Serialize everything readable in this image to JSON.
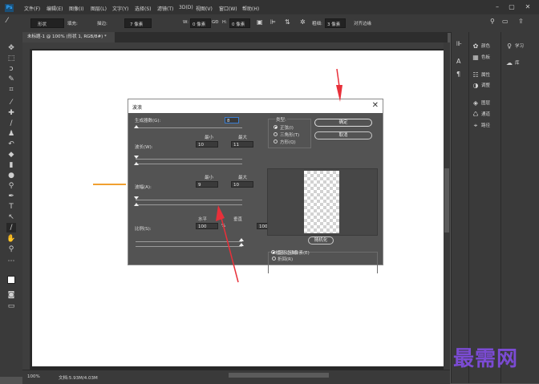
{
  "app": {
    "logo_text": "Ps"
  },
  "menubar": {
    "items": [
      "文件(F)",
      "编辑(E)",
      "图像(I)",
      "图层(L)",
      "文字(Y)",
      "选择(S)",
      "滤镜(T)",
      "3D(D)",
      "视图(V)",
      "窗口(W)",
      "帮助(H)"
    ]
  },
  "window_controls": {
    "minimize": "–",
    "maximize": "▢",
    "close": "✕"
  },
  "options_bar": {
    "shape_mode": "形状",
    "fill_label": "填充:",
    "stroke_label": "描边:",
    "stroke_width": "7 像素",
    "w_label": "W:",
    "w_value": "0 像素",
    "link": "GĐ",
    "h_label": "H:",
    "h_value": "0 像素",
    "weight_label": "粗细:",
    "weight_value": "3 像素",
    "align_edges": "对齐边缘"
  },
  "document_tab": {
    "title": "未标题-1 @ 100% (形状 1, RGB/8#) *",
    "close": "×"
  },
  "status_bar": {
    "zoom": "100%",
    "doc_info": "文档:5.93M/4.03M"
  },
  "right_panels": {
    "color": "颜色",
    "swatches": "色板",
    "learn": "学习",
    "libraries": "库",
    "properties": "属性",
    "adjustments": "调整",
    "layers": "图层",
    "channels": "通道",
    "paths": "路径"
  },
  "wave_dialog": {
    "title": "波浪",
    "generators_label": "生成器数(G):",
    "generators_value": "8",
    "min_label": "最小",
    "max_label": "最大",
    "wavelength_label": "波长(W):",
    "wavelength_min": "10",
    "wavelength_max": "11",
    "amplitude_min_label": "最小",
    "amplitude_max_label": "最大",
    "amplitude_label": "波幅(A):",
    "amplitude_min": "9",
    "amplitude_max": "10",
    "horizontal_label": "水平",
    "vertical_label": "垂直",
    "scale_label": "比例(S):",
    "scale_h": "100",
    "scale_v": "100",
    "percent": "%",
    "type_label": "类型:",
    "type_options": [
      "正弦(I)",
      "三角形(T)",
      "方形(Q)"
    ],
    "type_selected": "正弦(I)",
    "ok_button": "确定",
    "cancel_button": "取消",
    "randomize_button": "随机化",
    "undefined_label": "未定义区域:",
    "undefined_options": [
      "折回(R)",
      "重复边缘像素(E)"
    ],
    "undefined_selected": "重复边缘像素(E)"
  },
  "watermark": "最需网",
  "colors": {
    "accent_orange": "#f0a030",
    "arrow_red": "#e8303a",
    "watermark": "#7b4bd3"
  }
}
